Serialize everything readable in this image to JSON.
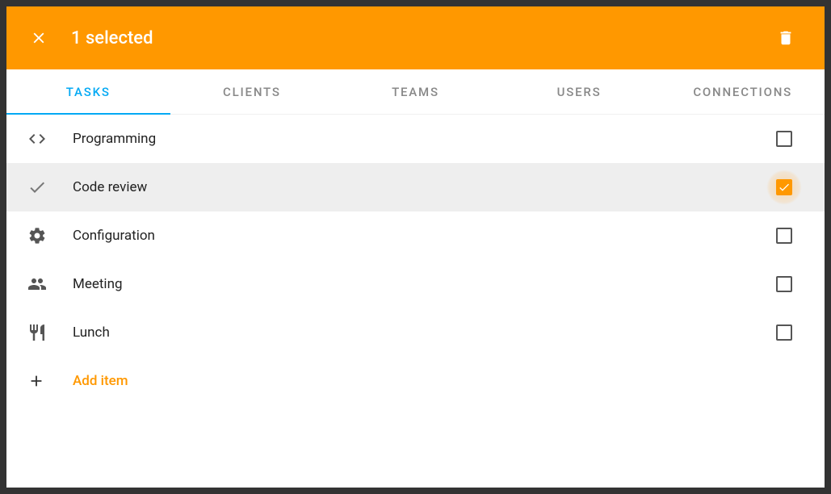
{
  "header": {
    "title": "1 selected"
  },
  "tabs": [
    {
      "label": "TASKS",
      "active": true
    },
    {
      "label": "CLIENTS",
      "active": false
    },
    {
      "label": "TEAMS",
      "active": false
    },
    {
      "label": "USERS",
      "active": false
    },
    {
      "label": "CONNECTIONS",
      "active": false
    }
  ],
  "items": [
    {
      "icon": "code",
      "label": "Programming",
      "checked": false
    },
    {
      "icon": "check",
      "label": "Code review",
      "checked": true
    },
    {
      "icon": "gear",
      "label": "Configuration",
      "checked": false
    },
    {
      "icon": "people",
      "label": "Meeting",
      "checked": false
    },
    {
      "icon": "restaurant",
      "label": "Lunch",
      "checked": false
    }
  ],
  "addItem": {
    "label": "Add item"
  }
}
